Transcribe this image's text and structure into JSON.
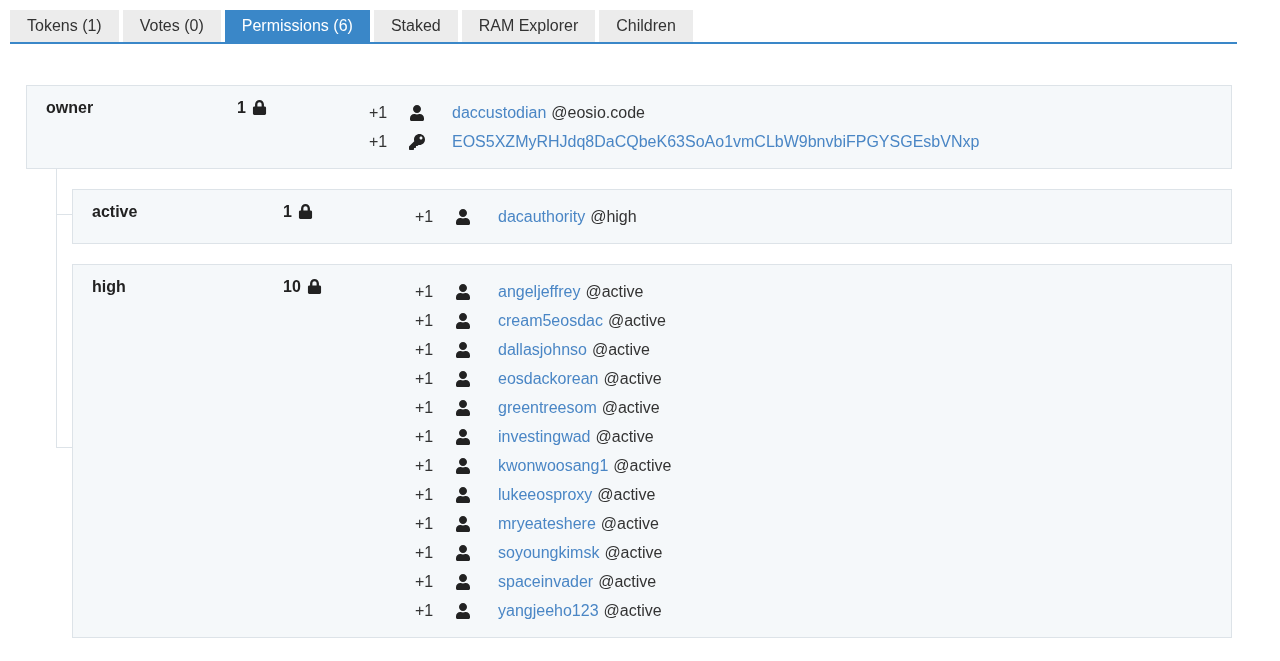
{
  "tabs": [
    {
      "label": "Tokens (1)",
      "selected": false
    },
    {
      "label": "Votes (0)",
      "selected": false
    },
    {
      "label": "Permissions (6)",
      "selected": true
    },
    {
      "label": "Staked",
      "selected": false
    },
    {
      "label": "RAM Explorer",
      "selected": false
    },
    {
      "label": "Children",
      "selected": false
    }
  ],
  "permissions": {
    "name": "owner",
    "threshold": "1",
    "keys": [
      {
        "weight": "+1",
        "kind": "account",
        "account": "daccustodian",
        "permission": "@eosio.code"
      },
      {
        "weight": "+1",
        "kind": "key",
        "account": "EOS5XZMyRHJdq8DaCQbeK63SoAo1vmCLbW9bnvbiFPGYSGEsbVNxp"
      }
    ],
    "children": [
      {
        "name": "active",
        "threshold": "1",
        "keys": [
          {
            "weight": "+1",
            "kind": "account",
            "account": "dacauthority",
            "permission": "@high"
          }
        ]
      },
      {
        "name": "high",
        "threshold": "10",
        "keys": [
          {
            "weight": "+1",
            "kind": "account",
            "account": "angeljeffrey",
            "permission": "@active"
          },
          {
            "weight": "+1",
            "kind": "account",
            "account": "cream5eosdac",
            "permission": "@active"
          },
          {
            "weight": "+1",
            "kind": "account",
            "account": "dallasjohnso",
            "permission": "@active"
          },
          {
            "weight": "+1",
            "kind": "account",
            "account": "eosdackorean",
            "permission": "@active"
          },
          {
            "weight": "+1",
            "kind": "account",
            "account": "greentreesom",
            "permission": "@active"
          },
          {
            "weight": "+1",
            "kind": "account",
            "account": "investingwad",
            "permission": "@active"
          },
          {
            "weight": "+1",
            "kind": "account",
            "account": "kwonwoosang1",
            "permission": "@active"
          },
          {
            "weight": "+1",
            "kind": "account",
            "account": "lukeeosproxy",
            "permission": "@active"
          },
          {
            "weight": "+1",
            "kind": "account",
            "account": "mryeateshere",
            "permission": "@active"
          },
          {
            "weight": "+1",
            "kind": "account",
            "account": "soyoungkimsk",
            "permission": "@active"
          },
          {
            "weight": "+1",
            "kind": "account",
            "account": "spaceinvader",
            "permission": "@active"
          },
          {
            "weight": "+1",
            "kind": "account",
            "account": "yangjeeho123",
            "permission": "@active"
          }
        ]
      }
    ]
  }
}
